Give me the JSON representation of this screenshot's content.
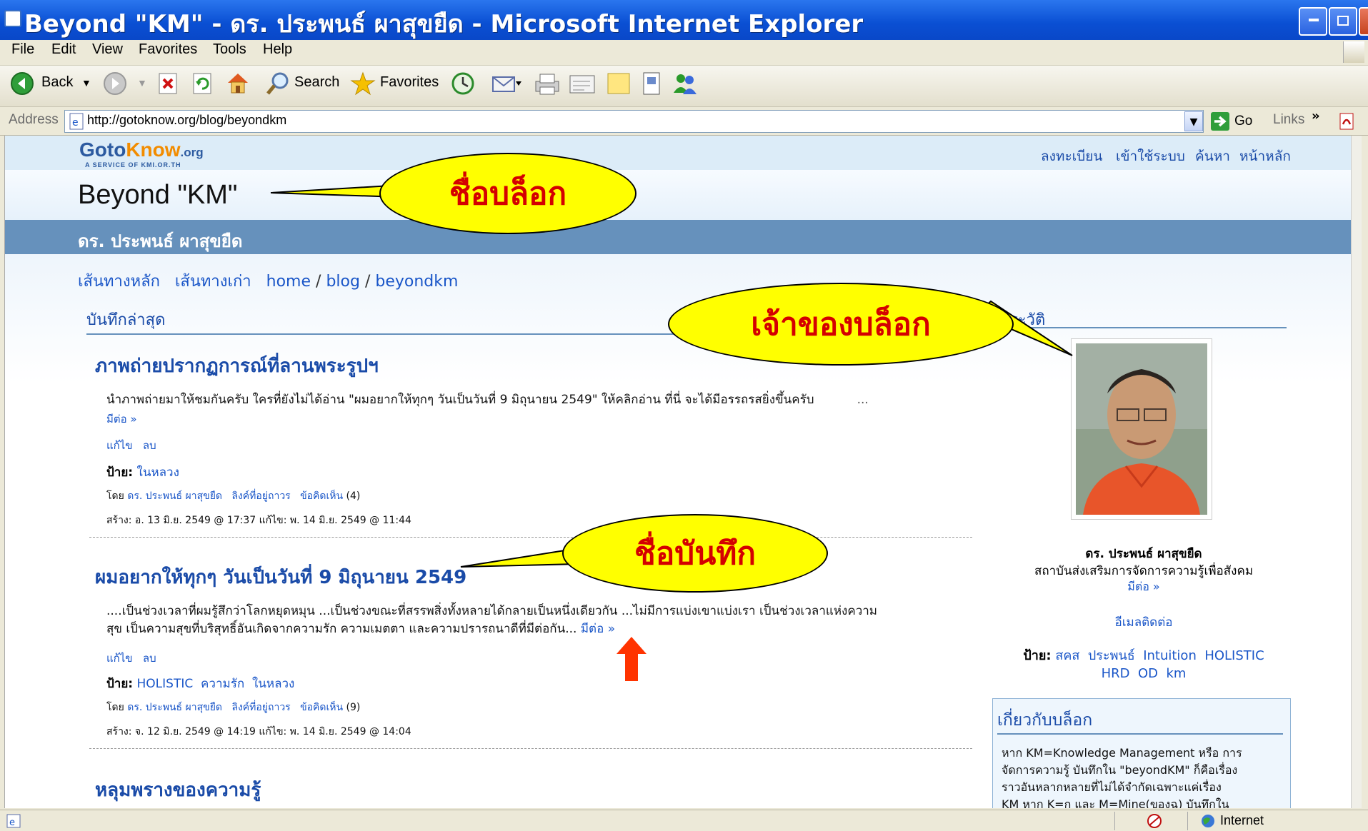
{
  "window": {
    "title": "Beyond \"KM\" - ดร. ประพนธ์ ผาสุขยืด - Microsoft Internet Explorer"
  },
  "menu": [
    "File",
    "Edit",
    "View",
    "Favorites",
    "Tools",
    "Help"
  ],
  "toolbar": {
    "back_label": "Back",
    "search_label": "Search",
    "favorites_label": "Favorites"
  },
  "address": {
    "label": "Address",
    "url": "http://gotoknow.org/blog/beyondkm",
    "go_label": "Go",
    "links_label": "Links"
  },
  "site": {
    "logo_goto": "Goto",
    "logo_know": "Know",
    "logo_org": ".org",
    "logo_tagline": "A SERVICE OF KMI.OR.TH",
    "top_nav": [
      "ลงทะเบียน",
      "เข้าใช้ระบบ",
      "ค้นหา",
      "หน้าหลัก"
    ],
    "blog_title": "Beyond \"KM\"",
    "author": "ดร. ประพนธ์ ผาสุขยืด",
    "breadcrumb": [
      "เส้นทางหลัก",
      "เส้นทางเก่า",
      "home",
      "/",
      "blog",
      "/",
      "beyondkm"
    ]
  },
  "main": {
    "section_heading": "บันทึกล่าสุด",
    "posts": [
      {
        "title": "ภาพถ่ายปรากฏการณ์ที่ลานพระรูปฯ",
        "body": "นำภาพถ่ายมาให้ชมกันครับ ใครที่ยังไม่ได้อ่าน \"ผมอยากให้ทุกๆ วันเป็นวันที่ 9 มิถุนายน 2549\" ให้คลิกอ่าน ที่นี่  จะได้มีอรรถรสยิ่งขึ้นครับ",
        "ellipsis": "...",
        "more": "มีต่อ »",
        "edit": "แก้ไข",
        "delete": "ลบ",
        "tags_label": "ป้าย:",
        "tags": [
          "ในหลวง"
        ],
        "by_label": "โดย",
        "by": "ดร. ประพนธ์ ผาสุขยืด",
        "permalink": "ลิงค์ที่อยู่ถาวร",
        "comments": "ข้อคิดเห็น",
        "comment_count": "(4)",
        "created": "สร้าง: อ. 13 มิ.ย. 2549 @ 17:37   แก้ไข: พ. 14 มิ.ย. 2549 @ 11:44"
      },
      {
        "title": "ผมอยากให้ทุกๆ วันเป็นวันที่ 9 มิถุนายน 2549",
        "body_line1": "....เป็นช่วงเวลาที่ผมรู้สึกว่าโลกหยุดหมุน ...เป็นช่วงขณะที่สรรพสิ่งทั้งหลายได้กลายเป็นหนึ่งเดียวกัน ...ไม่มีการแบ่งเขาแบ่งเรา เป็นช่วงเวลาแห่งความ",
        "body_line2": "สุข เป็นความสุขที่บริสุทธิ์อันเกิดจากความรัก ความเมตตา และความปรารถนาดีที่มีต่อกัน...",
        "more": "มีต่อ »",
        "edit": "แก้ไข",
        "delete": "ลบ",
        "tags_label": "ป้าย:",
        "tags": [
          "HOLISTIC",
          "ความรัก",
          "ในหลวง"
        ],
        "by_label": "โดย",
        "by": "ดร. ประพนธ์ ผาสุขยืด",
        "permalink": "ลิงค์ที่อยู่ถาวร",
        "comments": "ข้อคิดเห็น",
        "comment_count": "(9)",
        "created": "สร้าง: จ. 12 มิ.ย. 2549 @ 14:19   แก้ไข: พ. 14 มิ.ย. 2549 @ 14:04"
      },
      {
        "title": "หลุมพรางของความรู้"
      }
    ]
  },
  "sidebar": {
    "heading_partial": "ระวัติ",
    "name": "ดร. ประพนธ์ ผาสุขยืด",
    "org": "สถาบันส่งเสริมการจัดการความรู้เพื่อสังคม",
    "more": "มีต่อ »",
    "email": "อีเมลติดต่อ",
    "tags_label": "ป้าย:",
    "tags": [
      "สคส",
      "ประพนธ์",
      "Intuition",
      "HOLISTIC",
      "HRD",
      "OD",
      "km"
    ],
    "about_heading": "เกี่ยวกับบล็อก",
    "about_lines": [
      "หาก KM=Knowledge Management หรือ การ",
      "จัดการความรู้ บันทึกใน \"beyondKM\" ก็คือเรื่อง",
      "ราวอันหลากหลายที่ไม่ได้จำกัดเฉพาะแค่เรื่อง",
      "KM หาก K=ก และ M=Mine(ของฉ) บันทึกใน"
    ]
  },
  "callouts": {
    "blog_name": "ชื่อบล็อก",
    "blog_owner": "เจ้าของบล็อก",
    "post_name": "ชื่อบันทึก"
  },
  "status": {
    "zone": "Internet"
  },
  "colors": {
    "titlebar": "#0a4fd3",
    "link": "#1a4ba8",
    "author_band": "#6691bc",
    "callout_fill": "#ffff00",
    "callout_text": "#d40000",
    "arrow": "#ff3300"
  }
}
